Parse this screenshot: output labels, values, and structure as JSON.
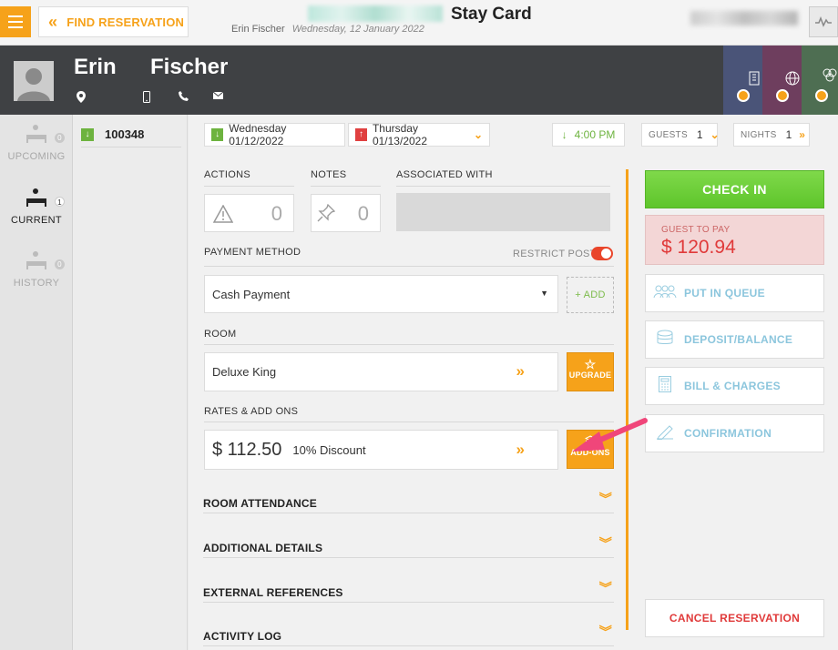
{
  "topbar": {
    "find_label": "FIND RESERVATION",
    "title": "Stay Card",
    "guest_name": "Erin Fischer",
    "date": "Wednesday, 12 January 2022"
  },
  "guest": {
    "first": "Erin",
    "last": "Fischer"
  },
  "nav": {
    "upcoming": {
      "label": "UPCOMING",
      "count": "0"
    },
    "current": {
      "label": "CURRENT",
      "count": "1"
    },
    "history": {
      "label": "HISTORY",
      "count": "0"
    }
  },
  "reservation": {
    "number": "100348"
  },
  "stay": {
    "arrival": "Wednesday 01/12/2022",
    "departure": "Thursday 01/13/2022",
    "time": "4:00 PM",
    "guests_label": "GUESTS",
    "guests": "1",
    "nights_label": "NIGHTS",
    "nights": "1"
  },
  "sections": {
    "actions_label": "ACTIONS",
    "actions_count": "0",
    "notes_label": "NOTES",
    "notes_count": "0",
    "associated_label": "ASSOCIATED WITH",
    "payment_label": "PAYMENT METHOD",
    "restrict_label": "RESTRICT POST",
    "payment_value": "Cash Payment",
    "add_label": "+ ADD",
    "room_label": "ROOM",
    "room_value": "Deluxe King",
    "upgrade_label": "UPGRADE",
    "rates_label": "RATES & ADD ONS",
    "rate_value": "$ 112.50",
    "rate_discount": "10% Discount",
    "addons_label": "ADD-ONS",
    "attendance": "ROOM ATTENDANCE",
    "additional": "ADDITIONAL DETAILS",
    "external": "EXTERNAL REFERENCES",
    "activity": "ACTIVITY LOG"
  },
  "right": {
    "checkin": "CHECK IN",
    "to_pay_label": "GUEST TO PAY",
    "to_pay_value": "$ 120.94",
    "queue": "PUT IN QUEUE",
    "deposit": "DEPOSIT/BALANCE",
    "bill": "BILL & CHARGES",
    "confirmation": "CONFIRMATION",
    "cancel": "CANCEL RESERVATION"
  },
  "colors": {
    "accent": "#f6a21a",
    "checkin": "#6cd137",
    "danger": "#e03a3a"
  }
}
